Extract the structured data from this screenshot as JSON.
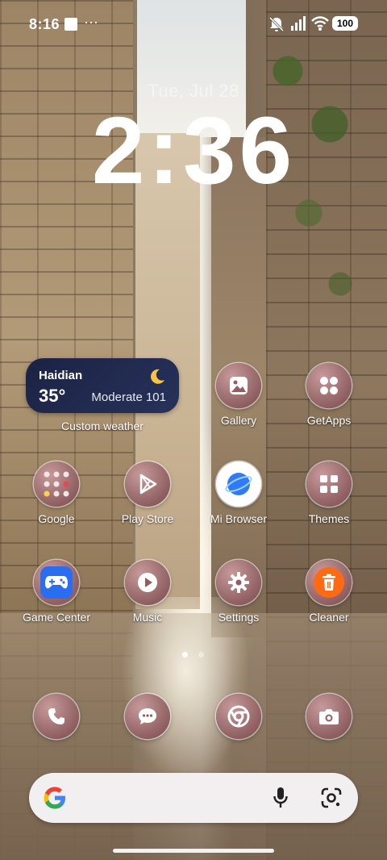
{
  "status_bar": {
    "time": "8:16",
    "more_indicator": "···",
    "battery": "100"
  },
  "lockscreen": {
    "date": "Tue, Jul 28",
    "clock": "2:36"
  },
  "weather_widget": {
    "city": "Haidian",
    "temperature": "35°",
    "air_quality": "Moderate 101",
    "label": "Custom weather"
  },
  "apps": [
    {
      "label": "Gallery"
    },
    {
      "label": "GetApps"
    },
    {
      "label": "Google"
    },
    {
      "label": "Play Store"
    },
    {
      "label": "Mi Browser"
    },
    {
      "label": "Themes"
    },
    {
      "label": "Game Center"
    },
    {
      "label": "Music"
    },
    {
      "label": "Settings"
    },
    {
      "label": "Cleaner"
    }
  ],
  "dock": [
    "phone-icon",
    "messages-icon",
    "chrome-icon",
    "camera-icon"
  ],
  "colors": {
    "icon_bg": "#8f5f62",
    "weather_bg": "#1b2344",
    "cleaner_accent": "#ff6a13",
    "browser_accent": "#2f7bf5"
  }
}
